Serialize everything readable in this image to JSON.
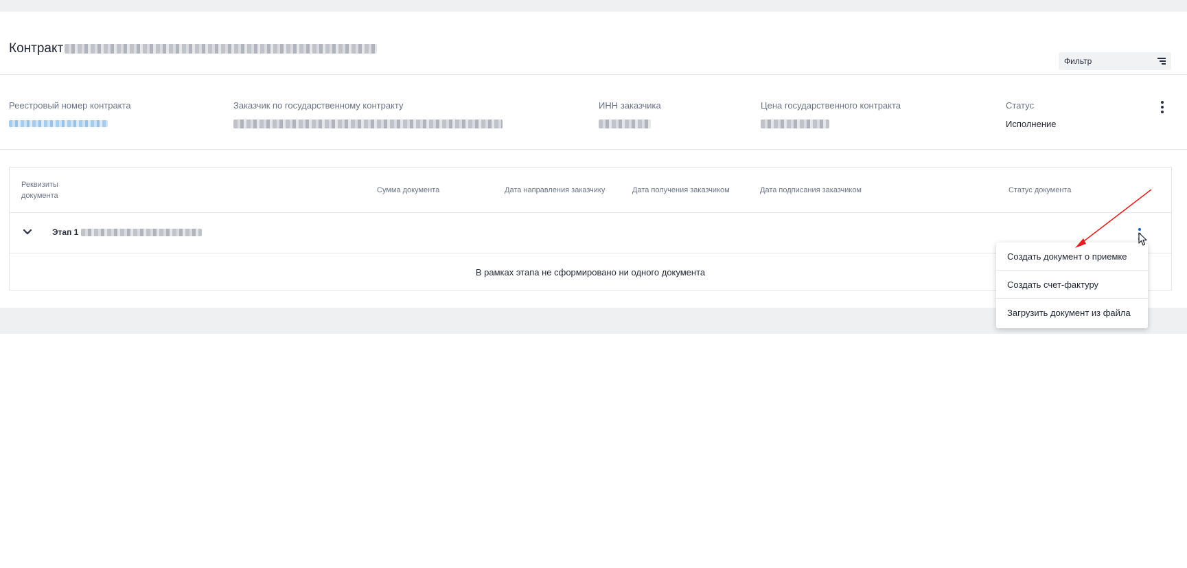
{
  "header": {
    "title": "Контракт",
    "filter_label": "Фильтр"
  },
  "info": {
    "registry_caption": "Реестровый номер контракта",
    "customer_caption": "Заказчик по государственному контракту",
    "inn_caption": "ИНН заказчика",
    "price_caption": "Цена государственного контракта",
    "status_caption": "Статус",
    "status_value": "Исполнение"
  },
  "table": {
    "columns": [
      "Реквизиты документа",
      "Сумма документа",
      "Дата направления заказчику",
      "Дата получения заказчиком",
      "Дата подписания заказчиком",
      "Статус документа"
    ],
    "stage_label": "Этап 1",
    "empty_message": "В рамках этапа не сформировано ни одного документа"
  },
  "menu": {
    "items": [
      "Создать документ о приемке",
      "Создать счет-фактуру",
      "Загрузить документ из файла"
    ]
  },
  "colors": {
    "accent": "#1d5fb5",
    "annotation_arrow": "#e02020"
  }
}
